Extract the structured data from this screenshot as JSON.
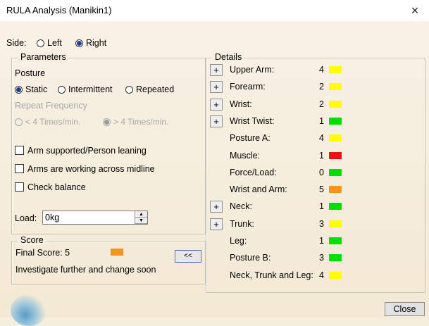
{
  "window": {
    "title": "RULA Analysis (Manikin1)",
    "close_glyph": "×"
  },
  "side": {
    "label": "Side:",
    "options": [
      "Left",
      "Right"
    ],
    "selected": "Right"
  },
  "parameters": {
    "group_label": "Parameters",
    "posture_label": "Posture",
    "posture_options": [
      "Static",
      "Intermittent",
      "Repeated"
    ],
    "posture_selected": "Static",
    "repeat_frequency_label": "Repeat Frequency",
    "frequency_options": [
      "< 4 Times/min.",
      "> 4 Times/min."
    ],
    "frequency_selected": "> 4 Times/min.",
    "checkboxes": [
      "Arm supported/Person leaning",
      "Arms are working across midline",
      "Check balance"
    ],
    "load_label": "Load:",
    "load_value": "0kg"
  },
  "score": {
    "group_label": "Score",
    "final_label": "Final Score: 5",
    "final_color": "#f7941d",
    "message": "Investigate further and change soon",
    "collapse_button": "<<"
  },
  "details": {
    "group_label": "Details",
    "expand_glyph": "+",
    "rows": [
      {
        "label": "Upper Arm:",
        "value": "4",
        "color": "#ffff00",
        "expandable": true
      },
      {
        "label": "Forearm:",
        "value": "2",
        "color": "#ffff00",
        "expandable": true
      },
      {
        "label": "Wrist:",
        "value": "2",
        "color": "#ffff00",
        "expandable": true
      },
      {
        "label": "Wrist Twist:",
        "value": "1",
        "color": "#00e000",
        "expandable": true
      },
      {
        "label": "Posture A:",
        "value": "4",
        "color": "#ffff00",
        "expandable": false
      },
      {
        "label": "Muscle:",
        "value": "1",
        "color": "#ee1111",
        "expandable": false
      },
      {
        "label": "Force/Load:",
        "value": "0",
        "color": "#00e000",
        "expandable": false
      },
      {
        "label": "Wrist and Arm:",
        "value": "5",
        "color": "#f7941d",
        "expandable": false
      },
      {
        "label": "Neck:",
        "value": "1",
        "color": "#00e000",
        "expandable": true
      },
      {
        "label": "Trunk:",
        "value": "3",
        "color": "#ffff00",
        "expandable": true
      },
      {
        "label": "Leg:",
        "value": "1",
        "color": "#00e000",
        "expandable": false
      },
      {
        "label": "Posture B:",
        "value": "3",
        "color": "#00e000",
        "expandable": false
      },
      {
        "label": "Neck, Trunk and Leg:",
        "value": "4",
        "color": "#ffff00",
        "expandable": false
      }
    ]
  },
  "footer": {
    "close_button": "Close"
  }
}
